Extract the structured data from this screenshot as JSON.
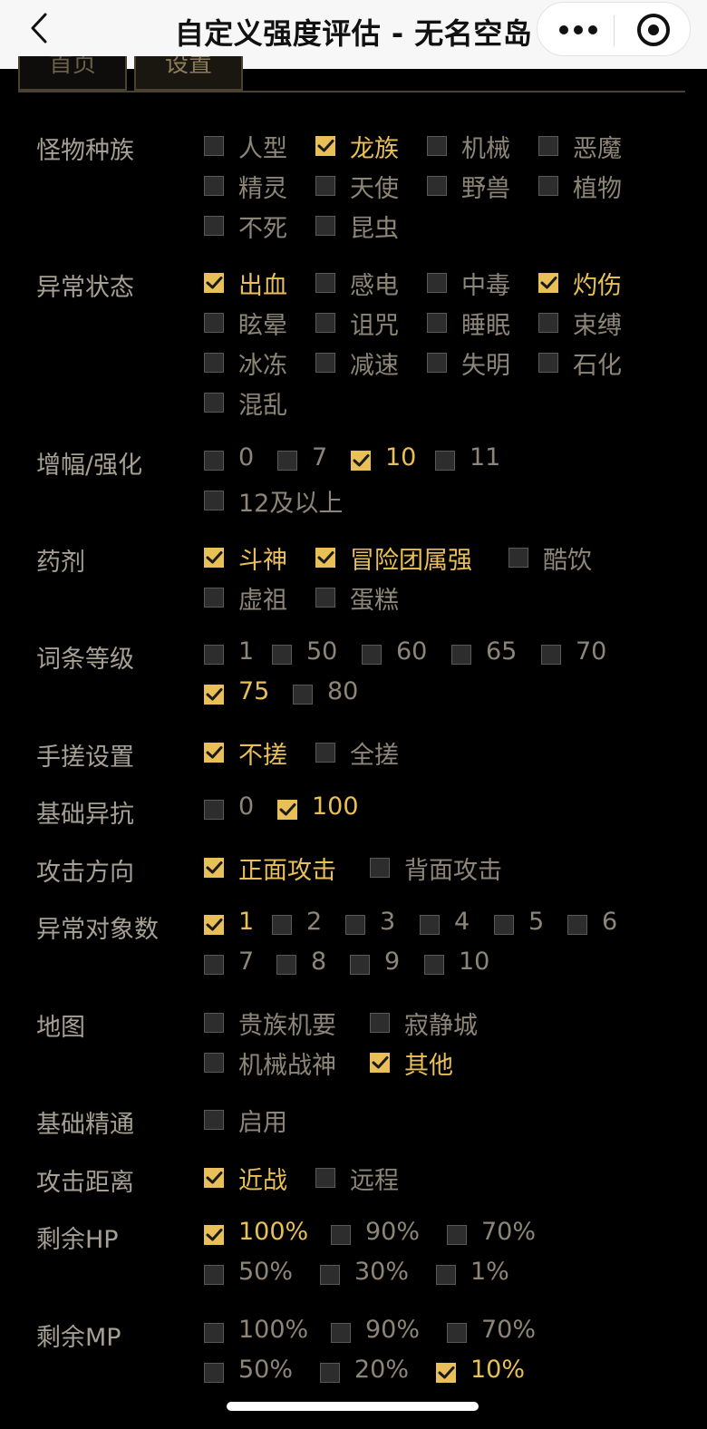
{
  "header": {
    "title": "自定义强度评估 - 无名空岛"
  },
  "tabs": [
    {
      "label": "首页"
    },
    {
      "label": "设置"
    }
  ],
  "sections": [
    {
      "key": "monster",
      "label": "怪物种族",
      "options": [
        {
          "label": "人型",
          "checked": false
        },
        {
          "label": "龙族",
          "checked": true
        },
        {
          "label": "机械",
          "checked": false
        },
        {
          "label": "恶魔",
          "checked": false
        },
        {
          "label": "精灵",
          "checked": false
        },
        {
          "label": "天使",
          "checked": false
        },
        {
          "label": "野兽",
          "checked": false
        },
        {
          "label": "植物",
          "checked": false
        },
        {
          "label": "不死",
          "checked": false
        },
        {
          "label": "昆虫",
          "checked": false
        }
      ]
    },
    {
      "key": "status",
      "label": "异常状态",
      "options": [
        {
          "label": "出血",
          "checked": true
        },
        {
          "label": "感电",
          "checked": false
        },
        {
          "label": "中毒",
          "checked": false
        },
        {
          "label": "灼伤",
          "checked": true
        },
        {
          "label": "眩晕",
          "checked": false
        },
        {
          "label": "诅咒",
          "checked": false
        },
        {
          "label": "睡眠",
          "checked": false
        },
        {
          "label": "束缚",
          "checked": false
        },
        {
          "label": "冰冻",
          "checked": false
        },
        {
          "label": "减速",
          "checked": false
        },
        {
          "label": "失明",
          "checked": false
        },
        {
          "label": "石化",
          "checked": false
        },
        {
          "label": "混乱",
          "checked": false
        }
      ]
    },
    {
      "key": "enhance",
      "label": "增幅/强化",
      "options": [
        {
          "label": "0",
          "checked": false
        },
        {
          "label": "7",
          "checked": false
        },
        {
          "label": "10",
          "checked": true
        },
        {
          "label": "11",
          "checked": false
        },
        {
          "label": "12及以上",
          "checked": false
        }
      ]
    },
    {
      "key": "potion",
      "label": "药剂",
      "options": [
        {
          "label": "斗神",
          "checked": true
        },
        {
          "label": "冒险团属强",
          "checked": true
        },
        {
          "label": "酷饮",
          "checked": false
        },
        {
          "label": "虚祖",
          "checked": false
        },
        {
          "label": "蛋糕",
          "checked": false
        }
      ]
    },
    {
      "key": "affix",
      "label": "词条等级",
      "options": [
        {
          "label": "1",
          "checked": false
        },
        {
          "label": "50",
          "checked": false
        },
        {
          "label": "60",
          "checked": false
        },
        {
          "label": "65",
          "checked": false
        },
        {
          "label": "70",
          "checked": false
        },
        {
          "label": "75",
          "checked": true
        },
        {
          "label": "80",
          "checked": false
        }
      ]
    },
    {
      "key": "manual",
      "label": "手搓设置",
      "options": [
        {
          "label": "不搓",
          "checked": true
        },
        {
          "label": "全搓",
          "checked": false
        }
      ]
    },
    {
      "key": "baseres",
      "label": "基础异抗",
      "options": [
        {
          "label": "0",
          "checked": false
        },
        {
          "label": "100",
          "checked": true
        }
      ]
    },
    {
      "key": "direction",
      "label": "攻击方向",
      "options": [
        {
          "label": "正面攻击",
          "checked": true
        },
        {
          "label": "背面攻击",
          "checked": false
        }
      ]
    },
    {
      "key": "targets",
      "label": "异常对象数",
      "options": [
        {
          "label": "1",
          "checked": true
        },
        {
          "label": "2",
          "checked": false
        },
        {
          "label": "3",
          "checked": false
        },
        {
          "label": "4",
          "checked": false
        },
        {
          "label": "5",
          "checked": false
        },
        {
          "label": "6",
          "checked": false
        },
        {
          "label": "7",
          "checked": false
        },
        {
          "label": "8",
          "checked": false
        },
        {
          "label": "9",
          "checked": false
        },
        {
          "label": "10",
          "checked": false
        }
      ]
    },
    {
      "key": "map",
      "label": "地图",
      "options": [
        {
          "label": "贵族机要",
          "checked": false
        },
        {
          "label": "寂静城",
          "checked": false
        },
        {
          "label": "机械战神",
          "checked": false
        },
        {
          "label": "其他",
          "checked": true
        }
      ]
    },
    {
      "key": "mastery",
      "label": "基础精通",
      "options": [
        {
          "label": "启用",
          "checked": false
        }
      ]
    },
    {
      "key": "range",
      "label": "攻击距离",
      "options": [
        {
          "label": "近战",
          "checked": true
        },
        {
          "label": "远程",
          "checked": false
        }
      ]
    },
    {
      "key": "hp",
      "label": "剩余HP",
      "options": [
        {
          "label": "100%",
          "checked": true
        },
        {
          "label": "90%",
          "checked": false
        },
        {
          "label": "70%",
          "checked": false
        },
        {
          "label": "50%",
          "checked": false
        },
        {
          "label": "30%",
          "checked": false
        },
        {
          "label": "1%",
          "checked": false
        }
      ]
    },
    {
      "key": "mp",
      "label": "剩余MP",
      "options": [
        {
          "label": "100%",
          "checked": false
        },
        {
          "label": "90%",
          "checked": false
        },
        {
          "label": "70%",
          "checked": false
        },
        {
          "label": "50%",
          "checked": false
        },
        {
          "label": "20%",
          "checked": false
        },
        {
          "label": "10%",
          "checked": true
        }
      ]
    }
  ],
  "colors": {
    "accent": "#e9bf57",
    "label": "#a69f93",
    "option": "#8d8577",
    "background": "#000000"
  },
  "icons": {
    "back": "chevron-left-icon",
    "more": "more-dots-icon",
    "target": "target-icon",
    "check": "check-icon"
  }
}
